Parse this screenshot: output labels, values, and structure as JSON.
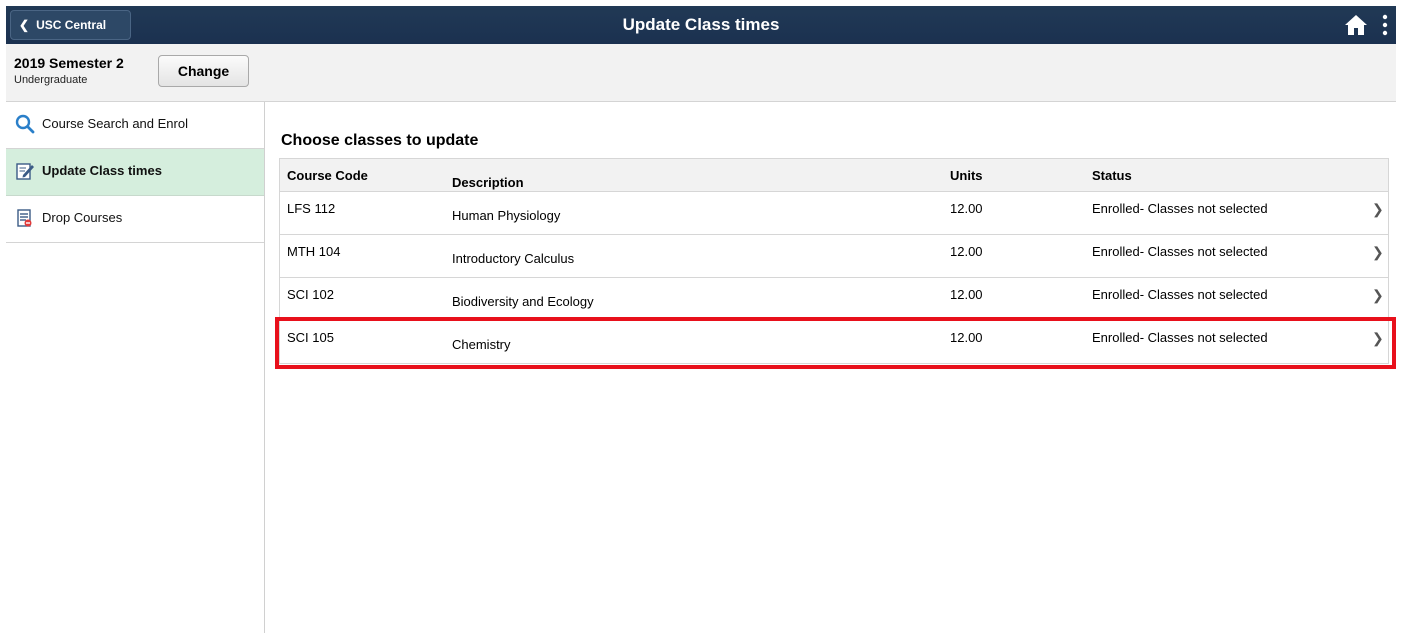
{
  "header": {
    "back_label": "USC Central",
    "title": "Update Class times",
    "home_icon": "home-icon",
    "menu_icon": "kebab-menu-icon"
  },
  "context": {
    "term": "2019 Semester 2",
    "career": "Undergraduate",
    "change_label": "Change"
  },
  "sidebar": {
    "items": [
      {
        "label": "Course Search and Enrol",
        "icon": "search-icon"
      },
      {
        "label": "Update Class times",
        "icon": "edit-icon"
      },
      {
        "label": "Drop Courses",
        "icon": "drop-list-icon"
      }
    ]
  },
  "main": {
    "section_title": "Choose classes to update",
    "columns": {
      "code": "Course Code",
      "description": "Description",
      "units": "Units",
      "status": "Status"
    },
    "rows": [
      {
        "code": "LFS 112",
        "description": "Human Physiology",
        "units": "12.00",
        "status": "Enrolled- Classes not selected"
      },
      {
        "code": "MTH 104",
        "description": "Introductory Calculus",
        "units": "12.00",
        "status": "Enrolled- Classes not selected"
      },
      {
        "code": "SCI 102",
        "description": "Biodiversity and Ecology",
        "units": "12.00",
        "status": "Enrolled- Classes not selected"
      },
      {
        "code": "SCI 105",
        "description": "Chemistry",
        "units": "12.00",
        "status": "Enrolled- Classes not selected"
      }
    ],
    "highlighted_row": "SCI 105"
  },
  "colors": {
    "header_bg": "#1b3150",
    "active_nav_bg": "#d5eedd",
    "highlight_border": "#e8101b"
  }
}
